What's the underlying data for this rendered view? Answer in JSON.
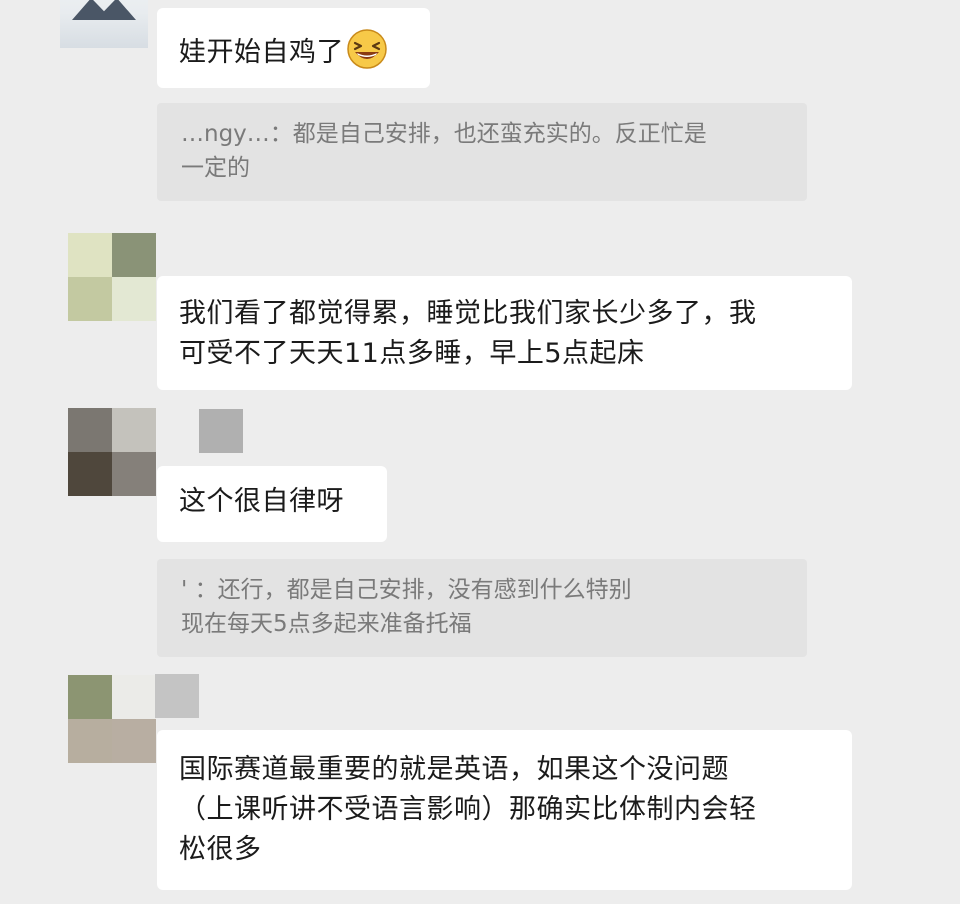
{
  "messages": [
    {
      "text": "娃开始自鸡了",
      "emoji": "grinning-squint-face-emoji"
    },
    {
      "quote": "…ngy…：都是自己安排，也还蛮充实的。反正忙是\n一定的"
    },
    {
      "text": "我们看了都觉得累，睡觉比我们家长少多了，我\n可受不了天天11点多睡，早上5点起床"
    },
    {
      "text": "这个很自律呀"
    },
    {
      "quote": "' ：还行，都是自己安排，没有感到什么特别\n现在每天5点多起来准备托福"
    },
    {
      "text": "国际赛道最重要的就是英语，如果这个没问题\n（上课听讲不受语言影响）那确实比体制内会轻\n松很多"
    }
  ],
  "colors": {
    "background": "#ededed",
    "bubble": "#ffffff",
    "quote_bg": "#e3e3e3",
    "quote_text": "#7a7a7a"
  },
  "icons": {
    "avatar_1": "user-photo-avatar",
    "avatar_2": "mosaic-avatar",
    "avatar_3": "mosaic-avatar",
    "avatar_4": "mosaic-avatar"
  }
}
